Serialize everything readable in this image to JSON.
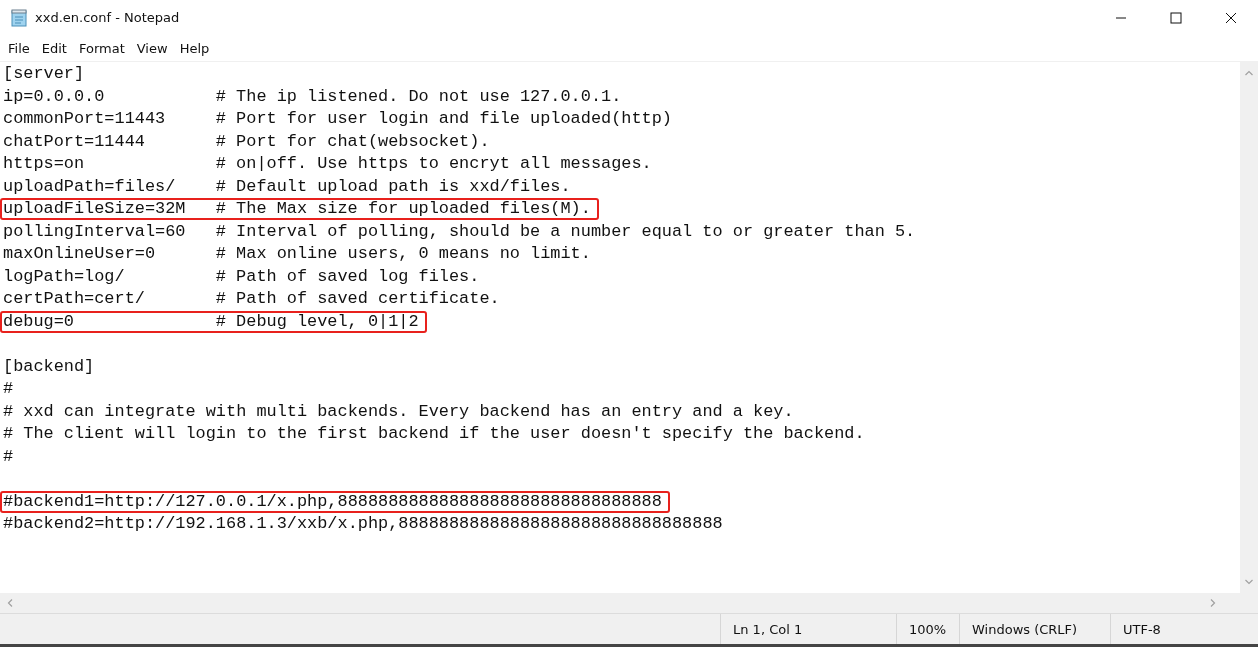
{
  "window": {
    "title": "xxd.en.conf - Notepad"
  },
  "menu": [
    "File",
    "Edit",
    "Format",
    "View",
    "Help"
  ],
  "editor": {
    "lines": [
      {
        "kind": "text",
        "text": "[server]",
        "highlighted": false
      },
      {
        "kind": "setting",
        "key": "ip=0.0.0.0",
        "comment": "# The ip listened. Do not use 127.0.0.1.",
        "highlighted": false
      },
      {
        "kind": "setting",
        "key": "commonPort=11443",
        "comment": "# Port for user login and file uploaded(http)",
        "highlighted": false
      },
      {
        "kind": "setting",
        "key": "chatPort=11444",
        "comment": "# Port for chat(websocket).",
        "highlighted": false
      },
      {
        "kind": "setting",
        "key": "https=on",
        "comment": "# on|off. Use https to encryt all messages.",
        "highlighted": false
      },
      {
        "kind": "setting",
        "key": "uploadPath=files/",
        "comment": "# Default upload path is xxd/files.",
        "highlighted": false
      },
      {
        "kind": "setting",
        "key": "uploadFileSize=32M",
        "comment": "# The Max size for uploaded files(M).",
        "highlighted": true
      },
      {
        "kind": "setting",
        "key": "pollingInterval=60",
        "comment": "# Interval of polling, should be a number equal to or greater than 5.",
        "highlighted": false
      },
      {
        "kind": "setting",
        "key": "maxOnlineUser=0",
        "comment": "# Max online users, 0 means no limit.",
        "highlighted": false
      },
      {
        "kind": "setting",
        "key": "logPath=log/",
        "comment": "# Path of saved log files.",
        "highlighted": false
      },
      {
        "kind": "setting",
        "key": "certPath=cert/",
        "comment": "# Path of saved certificate.",
        "highlighted": false
      },
      {
        "kind": "setting",
        "key": "debug=0",
        "comment": "# Debug level, 0|1|2",
        "highlighted": true
      },
      {
        "kind": "blank"
      },
      {
        "kind": "text",
        "text": "[backend]",
        "highlighted": false
      },
      {
        "kind": "text",
        "text": "#",
        "highlighted": false
      },
      {
        "kind": "text",
        "text": "# xxd can integrate with multi backends. Every backend has an entry and a key.",
        "highlighted": false
      },
      {
        "kind": "text",
        "text": "# The client will login to the first backend if the user doesn't specify the backend.",
        "highlighted": false
      },
      {
        "kind": "text",
        "text": "#",
        "highlighted": false
      },
      {
        "kind": "blank"
      },
      {
        "kind": "text",
        "text": "#backend1=http://127.0.0.1/x.php,88888888888888888888888888888888",
        "highlighted": true
      },
      {
        "kind": "text",
        "text": "#backend2=http://192.168.1.3/xxb/x.php,88888888888888888888888888888888",
        "highlighted": false
      }
    ]
  },
  "status_bar": {
    "position": "Ln 1, Col 1",
    "zoom": "100%",
    "line_endings": "Windows (CRLF)",
    "encoding": "UTF-8"
  }
}
